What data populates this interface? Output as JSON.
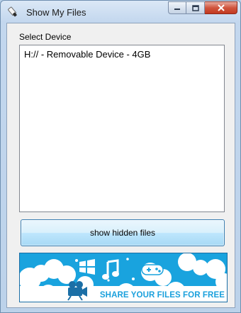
{
  "window": {
    "title": "Show My Files",
    "icon": "usb-drive-icon"
  },
  "controls": {
    "minimize_icon": "minimize-icon",
    "maximize_icon": "maximize-icon",
    "close_icon": "close-icon"
  },
  "device_panel": {
    "label": "Select Device",
    "items": [
      "H:// - Removable Device - 4GB"
    ]
  },
  "actions": {
    "show_hidden_label": "show hidden files"
  },
  "banner": {
    "text": "SHARE YOUR FILES FOR FREE",
    "icons": [
      "windows-icon",
      "music-note-icon",
      "gamepad-icon",
      "video-camera-icon"
    ],
    "colors": {
      "sky": "#19a3de",
      "cloud": "#ffffff",
      "text": "#1aa0dc"
    }
  }
}
